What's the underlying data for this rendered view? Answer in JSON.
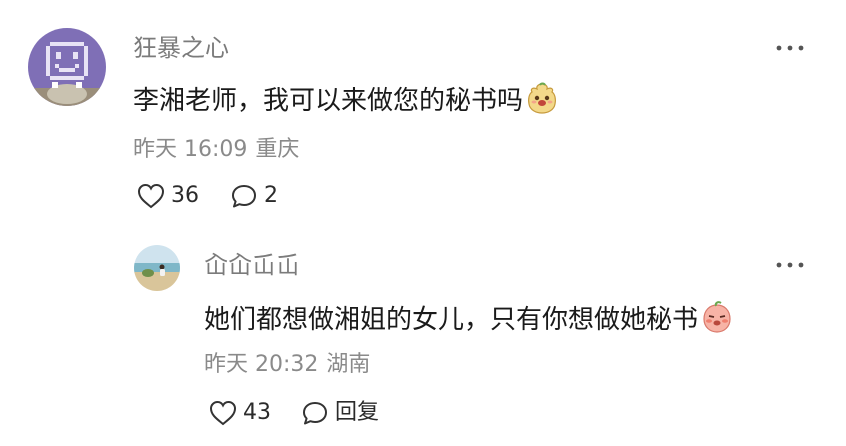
{
  "comment": {
    "username": "狂暴之心",
    "text": "李湘老师，我可以来做您的秘书吗",
    "emoji_icon": "peach-face-sticker-icon",
    "time": "昨天 16:09",
    "location": "重庆",
    "likes": "36",
    "replies": "2"
  },
  "reply": {
    "username": "屳屳屲屲",
    "text": "她们都想做湘姐的女儿，只有你想做她秘书",
    "emoji_icon": "blushing-peach-sticker-icon",
    "time": "昨天 20:32",
    "location": "湖南",
    "likes": "43",
    "reply_label": "回复"
  },
  "colors": {
    "avatar_purple": "#7f6fb6",
    "username": "#7b7b7b",
    "text": "#1a1a1a",
    "meta": "#8a8a8a"
  }
}
